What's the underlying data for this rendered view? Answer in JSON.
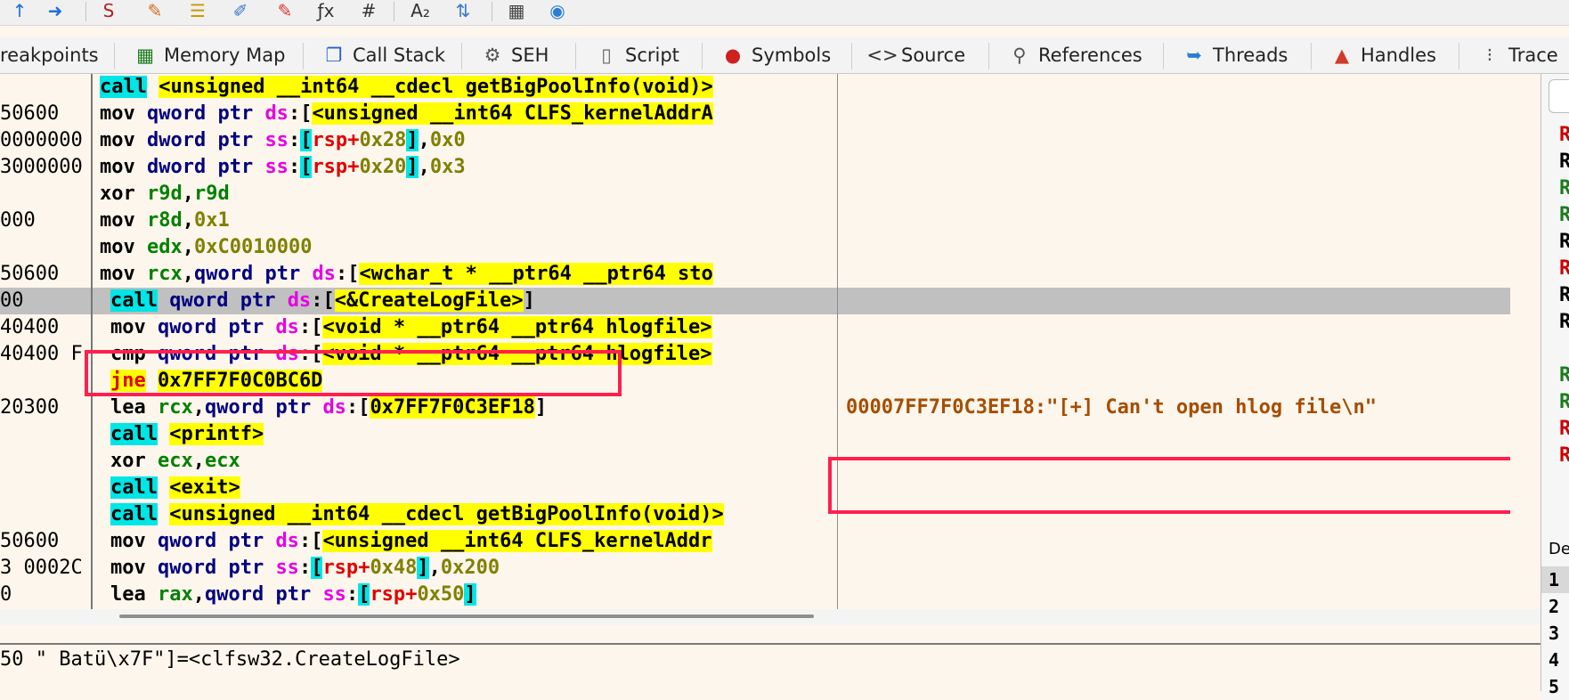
{
  "toolbar": {
    "icons": [
      {
        "name": "step-up-icon",
        "glyph": "↑",
        "color": "#1e6fd9"
      },
      {
        "name": "user-arrow-icon",
        "glyph": "➜",
        "color": "#1e6fd9"
      },
      {
        "name": "script-red-icon",
        "glyph": "S",
        "color": "#b22222"
      },
      {
        "name": "pencil-icon",
        "glyph": "✎",
        "color": "#d2691e"
      },
      {
        "name": "label-icon",
        "glyph": "☰",
        "color": "#c89b00"
      },
      {
        "name": "comment-icon",
        "glyph": "✐",
        "color": "#3a79c9"
      },
      {
        "name": "bookmark-icon",
        "glyph": "✎",
        "color": "#e03030"
      },
      {
        "name": "function-icon",
        "glyph": "ƒx",
        "color": "#333333"
      },
      {
        "name": "hash-icon",
        "glyph": "#",
        "color": "#333333"
      },
      {
        "name": "font-size-icon",
        "glyph": "A₂",
        "color": "#333333"
      },
      {
        "name": "transfer-icon",
        "glyph": "⇅",
        "color": "#3a79c9"
      },
      {
        "name": "calculator-icon",
        "glyph": "▦",
        "color": "#444444"
      },
      {
        "name": "globe-icon",
        "glyph": "◉",
        "color": "#2a7fd4"
      }
    ]
  },
  "tabs": [
    {
      "label": "reakpoints",
      "icon": "",
      "icon_name": "breakpoints-icon",
      "color": "#333333"
    },
    {
      "label": "Memory Map",
      "icon": "▦",
      "icon_name": "memory-map-icon",
      "color": "#1c7c1c"
    },
    {
      "label": "Call Stack",
      "icon": "❐",
      "icon_name": "call-stack-icon",
      "color": "#2a62c9"
    },
    {
      "label": "SEH",
      "icon": "⚙",
      "icon_name": "seh-icon",
      "color": "#555555"
    },
    {
      "label": "Script",
      "icon": "▯",
      "icon_name": "script-icon",
      "color": "#666666"
    },
    {
      "label": "Symbols",
      "icon": "●",
      "icon_name": "symbols-icon",
      "color": "#cc2222"
    },
    {
      "label": "Source",
      "icon": "<>",
      "icon_name": "source-icon",
      "color": "#333333"
    },
    {
      "label": "References",
      "icon": "⚲",
      "icon_name": "references-icon",
      "color": "#555555"
    },
    {
      "label": "Threads",
      "icon": "➥",
      "icon_name": "threads-icon",
      "color": "#2a7fd4"
    },
    {
      "label": "Handles",
      "icon": "▲",
      "icon_name": "handles-icon",
      "color": "#d33a2a"
    },
    {
      "label": "Trace",
      "icon": "⁝",
      "icon_name": "trace-icon",
      "color": "#555555"
    }
  ],
  "addresses": [
    "",
    "50600",
    "0000000",
    "3000000",
    "",
    "000",
    "",
    "50600",
    "00",
    "40400",
    "40400 F",
    "",
    "20300",
    "",
    "",
    "",
    "",
    "50600",
    "3 0002C",
    "0"
  ],
  "lines": [
    {
      "tokens": [
        {
          "t": "call",
          "c": "kw-call"
        },
        {
          "t": " "
        },
        {
          "t": "<unsigned __int64 __cdecl getBigPoolInfo(void)>",
          "c": "sym"
        }
      ]
    },
    {
      "tokens": [
        {
          "t": "mov ",
          "c": "mn"
        },
        {
          "t": "qword ptr ",
          "c": "ptr"
        },
        {
          "t": "ds",
          "c": "seg"
        },
        {
          "t": ":[",
          "c": "brk"
        },
        {
          "t": "<unsigned __int64 CLFS_kernelAddrA",
          "c": "sym"
        }
      ]
    },
    {
      "tokens": [
        {
          "t": "mov ",
          "c": "mn"
        },
        {
          "t": "dword ptr ",
          "c": "ptr"
        },
        {
          "t": "ss",
          "c": "seg"
        },
        {
          "t": ":"
        },
        {
          "t": "[",
          "c": "brk-hi"
        },
        {
          "t": "rsp",
          "c": "rsp"
        },
        {
          "t": "+",
          "c": "plus"
        },
        {
          "t": "0x28",
          "c": "num"
        },
        {
          "t": "]",
          "c": "brk-hi"
        },
        {
          "t": ","
        },
        {
          "t": "0x0",
          "c": "num"
        }
      ]
    },
    {
      "tokens": [
        {
          "t": "mov ",
          "c": "mn"
        },
        {
          "t": "dword ptr ",
          "c": "ptr"
        },
        {
          "t": "ss",
          "c": "seg"
        },
        {
          "t": ":"
        },
        {
          "t": "[",
          "c": "brk-hi"
        },
        {
          "t": "rsp",
          "c": "rsp"
        },
        {
          "t": "+",
          "c": "plus"
        },
        {
          "t": "0x20",
          "c": "num"
        },
        {
          "t": "]",
          "c": "brk-hi"
        },
        {
          "t": ","
        },
        {
          "t": "0x3",
          "c": "num"
        }
      ]
    },
    {
      "tokens": [
        {
          "t": "xor ",
          "c": "mn"
        },
        {
          "t": "r9d",
          "c": "reg"
        },
        {
          "t": ","
        },
        {
          "t": "r9d",
          "c": "reg"
        }
      ]
    },
    {
      "tokens": [
        {
          "t": "mov ",
          "c": "mn"
        },
        {
          "t": "r8d",
          "c": "reg"
        },
        {
          "t": ","
        },
        {
          "t": "0x1",
          "c": "num"
        }
      ]
    },
    {
      "tokens": [
        {
          "t": "mov ",
          "c": "mn"
        },
        {
          "t": "edx",
          "c": "reg"
        },
        {
          "t": ","
        },
        {
          "t": "0xC0010000",
          "c": "num"
        }
      ]
    },
    {
      "tokens": [
        {
          "t": "mov ",
          "c": "mn"
        },
        {
          "t": "rcx",
          "c": "reg"
        },
        {
          "t": ","
        },
        {
          "t": "qword ptr ",
          "c": "ptr"
        },
        {
          "t": "ds",
          "c": "seg"
        },
        {
          "t": ":[",
          "c": "brk"
        },
        {
          "t": "<wchar_t * __ptr64 __ptr64 sto",
          "c": "sym"
        }
      ]
    },
    {
      "tokens": [
        {
          "t": "call",
          "c": "kw-call"
        },
        {
          "t": " "
        },
        {
          "t": "qword ptr ",
          "c": "ptr"
        },
        {
          "t": "ds",
          "c": "seg"
        },
        {
          "t": ":[",
          "c": "brk"
        },
        {
          "t": "<&CreateLogFile>",
          "c": "sym"
        },
        {
          "t": "]",
          "c": "brk"
        }
      ]
    },
    {
      "tokens": [
        {
          "t": "mov ",
          "c": "mn"
        },
        {
          "t": "qword ptr ",
          "c": "ptr"
        },
        {
          "t": "ds",
          "c": "seg"
        },
        {
          "t": ":[",
          "c": "brk"
        },
        {
          "t": "<void * __ptr64 __ptr64 hlogfile>",
          "c": "sym"
        }
      ]
    },
    {
      "tokens": [
        {
          "t": "cmp ",
          "c": "mn"
        },
        {
          "t": "qword ptr ",
          "c": "ptr"
        },
        {
          "t": "ds",
          "c": "seg"
        },
        {
          "t": ":[",
          "c": "brk"
        },
        {
          "t": "<void * __ptr64 __ptr64 hlogfile>",
          "c": "sym"
        }
      ]
    },
    {
      "tokens": [
        {
          "t": "jne",
          "c": "kw-jne"
        },
        {
          "t": " "
        },
        {
          "t": "0x7FF7F0C0BC6D",
          "c": "addrv"
        }
      ]
    },
    {
      "tokens": [
        {
          "t": "lea ",
          "c": "mn"
        },
        {
          "t": "rcx",
          "c": "reg"
        },
        {
          "t": ","
        },
        {
          "t": "qword ptr ",
          "c": "ptr"
        },
        {
          "t": "ds",
          "c": "seg"
        },
        {
          "t": ":[",
          "c": "brk"
        },
        {
          "t": "0x7FF7F0C3EF18",
          "c": "addrv"
        },
        {
          "t": "]",
          "c": "brk"
        }
      ]
    },
    {
      "tokens": [
        {
          "t": "call",
          "c": "kw-call"
        },
        {
          "t": " "
        },
        {
          "t": "<printf>",
          "c": "sym"
        }
      ]
    },
    {
      "tokens": [
        {
          "t": "xor ",
          "c": "mn"
        },
        {
          "t": "ecx",
          "c": "reg"
        },
        {
          "t": ","
        },
        {
          "t": "ecx",
          "c": "reg"
        }
      ]
    },
    {
      "tokens": [
        {
          "t": "call",
          "c": "kw-call"
        },
        {
          "t": " "
        },
        {
          "t": "<exit>",
          "c": "sym"
        }
      ]
    },
    {
      "tokens": [
        {
          "t": "call",
          "c": "kw-call"
        },
        {
          "t": " "
        },
        {
          "t": "<unsigned __int64 __cdecl getBigPoolInfo(void)>",
          "c": "sym"
        }
      ]
    },
    {
      "tokens": [
        {
          "t": "mov ",
          "c": "mn"
        },
        {
          "t": "qword ptr ",
          "c": "ptr"
        },
        {
          "t": "ds",
          "c": "seg"
        },
        {
          "t": ":[",
          "c": "brk"
        },
        {
          "t": "<unsigned __int64 CLFS_kernelAddr",
          "c": "sym"
        }
      ]
    },
    {
      "tokens": [
        {
          "t": "mov ",
          "c": "mn"
        },
        {
          "t": "qword ptr ",
          "c": "ptr"
        },
        {
          "t": "ss",
          "c": "seg"
        },
        {
          "t": ":"
        },
        {
          "t": "[",
          "c": "brk-hi"
        },
        {
          "t": "rsp",
          "c": "rsp"
        },
        {
          "t": "+",
          "c": "plus"
        },
        {
          "t": "0x48",
          "c": "num"
        },
        {
          "t": "]",
          "c": "brk-hi"
        },
        {
          "t": ","
        },
        {
          "t": "0x200",
          "c": "num"
        }
      ]
    },
    {
      "tokens": [
        {
          "t": "lea ",
          "c": "mn"
        },
        {
          "t": "rax",
          "c": "reg"
        },
        {
          "t": ","
        },
        {
          "t": "qword ptr ",
          "c": "ptr"
        },
        {
          "t": "ss",
          "c": "seg"
        },
        {
          "t": ":"
        },
        {
          "t": "[",
          "c": "brk-hi"
        },
        {
          "t": "rsp",
          "c": "rsp"
        },
        {
          "t": "+",
          "c": "plus"
        },
        {
          "t": "0x50",
          "c": "num"
        },
        {
          "t": "]",
          "c": "brk-hi"
        }
      ]
    }
  ],
  "comment": "00007FF7F0C3EF18:\"[+] Can't open hlog file\\n\"",
  "info_text": "50 \" Batü\\x7F\"]=<clfsw32.CreateLogFile>",
  "right_panel": {
    "reg_marks": [
      {
        "t": "R",
        "color": "#cc0000"
      },
      {
        "t": "R",
        "color": "#000000"
      },
      {
        "t": "R",
        "color": "#1c7c1c"
      },
      {
        "t": "R",
        "color": "#1c7c1c"
      },
      {
        "t": "R",
        "color": "#000000"
      },
      {
        "t": "R",
        "color": "#cc0000"
      },
      {
        "t": "R",
        "color": "#000000"
      },
      {
        "t": "R",
        "color": "#000000"
      },
      {
        "t": "",
        "color": "#000000"
      },
      {
        "t": "R",
        "color": "#1c7c1c"
      },
      {
        "t": "R",
        "color": "#1c7c1c"
      },
      {
        "t": "R",
        "color": "#cc0000"
      },
      {
        "t": "R",
        "color": "#cc0000"
      }
    ],
    "de_label": "De",
    "nums": [
      "1",
      "2",
      "3",
      "4",
      "5"
    ]
  }
}
